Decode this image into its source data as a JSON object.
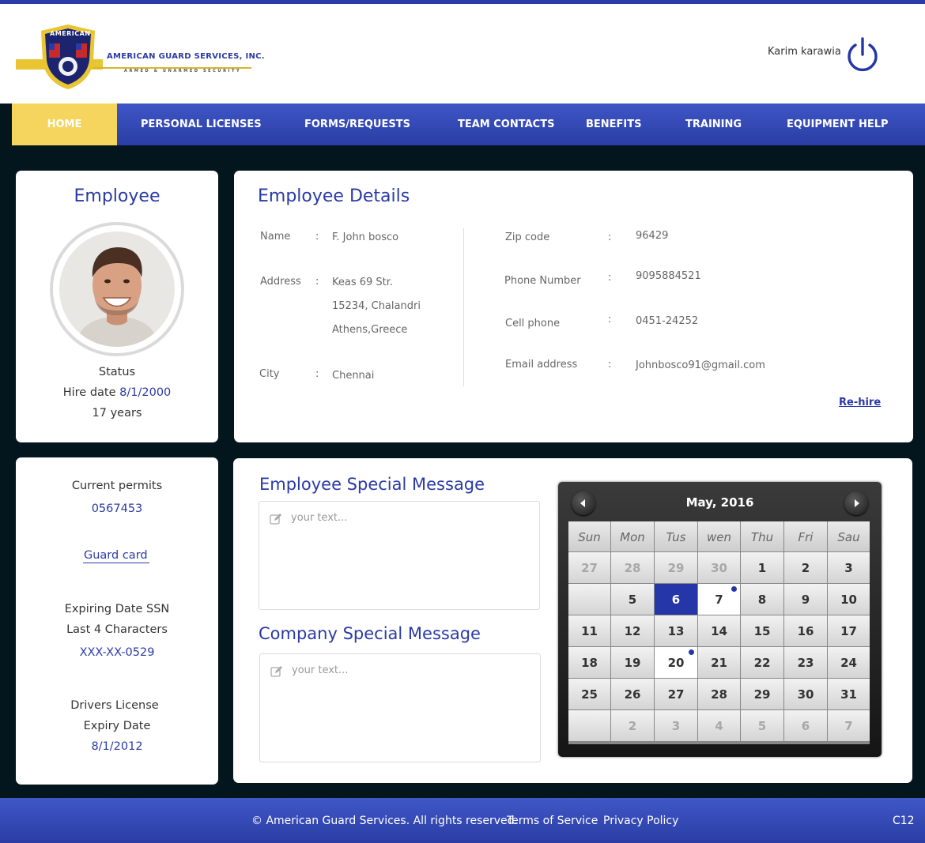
{
  "header": {
    "company_name": "AMERICAN GUARD SERVICES, INC.",
    "tagline": "ARMED & UNARMED SECURITY",
    "logo_text": "AMERICAN",
    "user_name": "Karim karawia",
    "power_icon": "power-icon"
  },
  "nav": {
    "items": [
      {
        "label": "HOME",
        "active": true
      },
      {
        "label": "PERSONAL LICENSES"
      },
      {
        "label": "FORMS/REQUESTS"
      },
      {
        "label": "TEAM CONTACTS"
      },
      {
        "label": "BENEFITS"
      },
      {
        "label": "TRAINING"
      },
      {
        "label": "EQUIPMENT HELP"
      }
    ]
  },
  "employee": {
    "title": "Employee",
    "status_label": "Status",
    "hire_date_label": "Hire date",
    "hire_date": "8/1/2000",
    "years": "17 years"
  },
  "details": {
    "title": "Employee Details",
    "name_label": "Name",
    "name": "F. John bosco",
    "address_label": "Address",
    "address_1": "Keas 69 Str.",
    "address_2": "15234, Chalandri",
    "address_3": "Athens,Greece",
    "city_label": "City",
    "city": "Chennai",
    "zip_label": "Zip code",
    "zip": "96429",
    "phone_label": "Phone Number",
    "phone": "9095884521",
    "cell_label": "Cell phone",
    "cell": "0451-24252",
    "email_label": "Email address",
    "email": "Johnbosco91@gmail.com",
    "colon": ":",
    "rehire": "Re-hire"
  },
  "permits": {
    "current_label": "Current permits",
    "current_value": "0567453",
    "guard_card": "Guard card",
    "ssn_label_1": "Expiring Date SSN",
    "ssn_label_2": "Last 4 Characters",
    "ssn_value": "XXX-XX-0529",
    "dl_label_1": "Drivers License",
    "dl_label_2": "Expiry Date",
    "dl_value": "8/1/2012"
  },
  "messages": {
    "employee_title": "Employee Special Message",
    "employee_placeholder": "your text...",
    "company_title": "Company Special Message",
    "company_placeholder": "your text..."
  },
  "calendar": {
    "title": "May, 2016",
    "weekdays": [
      "Sun",
      "Mon",
      "Tus",
      "wen",
      "Thu",
      "Fri",
      "Sau"
    ],
    "weeks": [
      [
        "27",
        "28",
        "29",
        "30",
        "1",
        "2",
        "3"
      ],
      [
        "",
        "5",
        "6",
        "7",
        "8",
        "9",
        "10"
      ],
      [
        "11",
        "12",
        "13",
        "14",
        "15",
        "16",
        "17"
      ],
      [
        "18",
        "19",
        "20",
        "21",
        "22",
        "23",
        "24"
      ],
      [
        "25",
        "26",
        "27",
        "28",
        "29",
        "30",
        "31"
      ],
      [
        "",
        "2",
        "3",
        "4",
        "5",
        "6",
        "7"
      ]
    ],
    "muted_cells": [
      [
        0,
        0
      ],
      [
        0,
        1
      ],
      [
        0,
        2
      ],
      [
        0,
        3
      ],
      [
        5,
        1
      ],
      [
        5,
        2
      ],
      [
        5,
        3
      ],
      [
        5,
        4
      ],
      [
        5,
        5
      ],
      [
        5,
        6
      ]
    ],
    "selected_cell": [
      1,
      2
    ],
    "white_cells": [
      [
        1,
        3
      ],
      [
        3,
        2
      ]
    ],
    "dot_cells": [
      [
        1,
        3
      ],
      [
        3,
        2
      ]
    ],
    "accent_color": "#2436a8"
  },
  "footer": {
    "copyright": "© American Guard Services. All rights reserved.",
    "terms": "Terms of Service",
    "privacy": "Privacy Policy",
    "code": "C12"
  }
}
